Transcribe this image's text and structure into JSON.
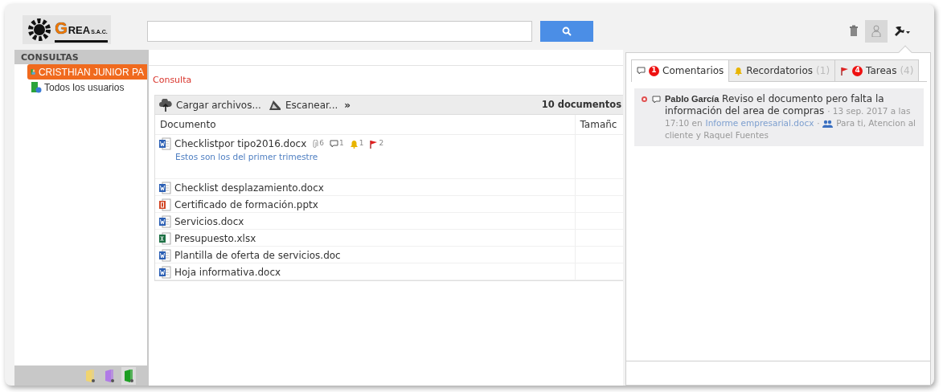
{
  "logo": {
    "initial": "G",
    "name": "REA",
    "suffix": "S.A.C."
  },
  "header_tools": [
    {
      "kind": "trash",
      "selected": false
    },
    {
      "kind": "user",
      "selected": true
    },
    {
      "kind": "wrench",
      "selected": false
    }
  ],
  "sidebar": {
    "title": "CONSULTAS",
    "items": [
      {
        "label": "CRISTHIAN JUNIOR PA",
        "kind": "user",
        "selected": true
      },
      {
        "label": "Todos los usuarios",
        "kind": "group",
        "selected": false
      }
    ],
    "folders": [
      {
        "color": "#f0d470",
        "selected": false
      },
      {
        "color": "#b07ae6",
        "selected": false
      },
      {
        "color": "#1c9e22",
        "selected": true
      }
    ]
  },
  "main": {
    "section_label": "Consulta",
    "toolbar": [
      {
        "kind": "upload",
        "label": "Cargar archivos..."
      },
      {
        "kind": "scan",
        "label": "Escanear..."
      },
      {
        "kind": "more",
        "label": "»"
      }
    ],
    "count": "10 documentos",
    "columns": [
      "Documento",
      "Tamañc"
    ],
    "rows": [
      {
        "name": "Checklistpor tipo2016.docx",
        "kind": "word",
        "badges": [
          {
            "kind": "attachment",
            "count": "6"
          },
          {
            "kind": "comment",
            "count": "1"
          },
          {
            "kind": "bell",
            "count": "1"
          },
          {
            "kind": "flag",
            "count": "2"
          }
        ],
        "note": "Estos son los del primer trimestre"
      },
      {
        "name": "Checklist desplazamiento.docx",
        "kind": "word"
      },
      {
        "name": "Certificado de formación.pptx",
        "kind": "powerpoint"
      },
      {
        "name": "Servicios.docx",
        "kind": "word"
      },
      {
        "name": "Presupuesto.xlsx",
        "kind": "excel"
      },
      {
        "name": "Plantilla de oferta de servicios.doc",
        "kind": "word"
      },
      {
        "name": "Hoja informativa.docx",
        "kind": "word"
      }
    ]
  },
  "panel": {
    "tabs": [
      {
        "kind": "comment",
        "badge": "1",
        "label": "Comentarios",
        "selected": true
      },
      {
        "kind": "bell",
        "label": "Recordatorios",
        "count": "(1)",
        "selected": false
      },
      {
        "kind": "flag",
        "badge": "4",
        "label": "Tareas",
        "count": "(4)",
        "selected": false
      }
    ],
    "comments": [
      {
        "unread": true,
        "author": "Pablo García",
        "text": "Reviso el documento pero falta la información del area de compras",
        "meta": "· 13 sep. 2017 a las 17:10 en",
        "document": "Informe empresarial.docx",
        "separator": "·",
        "recipients": "Para ti, Atencion al cliente y Raquel Fuentes"
      }
    ]
  }
}
